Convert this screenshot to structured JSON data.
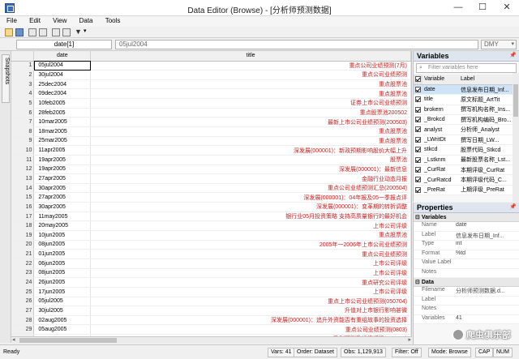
{
  "window": {
    "title": "Data Editor (Browse) - [分析师预测数据]",
    "controls": [
      "—",
      "☐",
      "✕"
    ]
  },
  "menu": [
    "File",
    "Edit",
    "View",
    "Data",
    "Tools"
  ],
  "varline": {
    "name": "date[1]",
    "value": "05jul2004",
    "format": "DMY"
  },
  "sidebar": {
    "snapshots_label": "Snapshots"
  },
  "grid": {
    "columns": [
      "date",
      "title"
    ],
    "rows": [
      {
        "n": "1",
        "date": "05jul2004",
        "title": "重点公司业绩预测(7月)"
      },
      {
        "n": "2",
        "date": "30jul2004",
        "title": "重点公司业绩预测"
      },
      {
        "n": "3",
        "date": "25dec2004",
        "title": "重点股票池"
      },
      {
        "n": "4",
        "date": "09dec2004",
        "title": "重点股票池"
      },
      {
        "n": "5",
        "date": "10feb2005",
        "title": "证券上市公司业绩预测"
      },
      {
        "n": "6",
        "date": "28feb2005",
        "title": "重点股票池200502"
      },
      {
        "n": "7",
        "date": "10mar2005",
        "title": "最新上市公司业绩预测(200503)"
      },
      {
        "n": "8",
        "date": "18mar2005",
        "title": "重点股票池"
      },
      {
        "n": "9",
        "date": "25mar2005",
        "title": "重点股票池"
      },
      {
        "n": "10",
        "date": "11apr2005",
        "title": "深发展(000001)：新政预期影响股价大幅上升"
      },
      {
        "n": "11",
        "date": "19apr2005",
        "title": "股票池"
      },
      {
        "n": "12",
        "date": "19apr2005",
        "title": "深发展(000001)：最新信息"
      },
      {
        "n": "13",
        "date": "27apr2005",
        "title": "金融行业动态月报"
      },
      {
        "n": "14",
        "date": "30apr2005",
        "title": "重点公司业绩预测汇总(200504)"
      },
      {
        "n": "15",
        "date": "27apr2005",
        "title": "深发展(000001)：04年报及05一季报点评"
      },
      {
        "n": "16",
        "date": "30apr2005",
        "title": "深发展(000001)：变革期的转折调整"
      },
      {
        "n": "17",
        "date": "11may2005",
        "title": "银行业05月投资策略 支持高质量银行的最好机会"
      },
      {
        "n": "18",
        "date": "20may2005",
        "title": "上市公司评级"
      },
      {
        "n": "19",
        "date": "10jun2005",
        "title": "重点股票池"
      },
      {
        "n": "20",
        "date": "08jun2005",
        "title": "2005年一2006年上市公司业绩预测"
      },
      {
        "n": "21",
        "date": "01jun2005",
        "title": "重点公司业绩预测"
      },
      {
        "n": "22",
        "date": "06jun2005",
        "title": "上市公司评级"
      },
      {
        "n": "23",
        "date": "08jun2005",
        "title": "上市公司评级"
      },
      {
        "n": "24",
        "date": "26jun2005",
        "title": "重点研究公司评级"
      },
      {
        "n": "25",
        "date": "17jun2005",
        "title": "上市公司评级"
      },
      {
        "n": "26",
        "date": "05jul2005",
        "title": "重点上市公司业绩预测(050704)"
      },
      {
        "n": "27",
        "date": "30jul2005",
        "title": "升值对上市银行影响甚微"
      },
      {
        "n": "28",
        "date": "02aug2005",
        "title": "深发展(000001)：追升外资能否有重组故事的投资选择"
      },
      {
        "n": "29",
        "date": "05aug2005",
        "title": "重点公司业绩预测(0803)"
      },
      {
        "n": "30",
        "date": "22aug2005",
        "title": "盈利预测及投资评级(050822)"
      },
      {
        "n": "31",
        "date": "23aug2005",
        "title": "重点股票评级"
      }
    ]
  },
  "variables": {
    "title": "Variables",
    "filter_placeholder": "Filter variables here",
    "col_variable": "Variable",
    "col_label": "Label",
    "items": [
      {
        "name": "date",
        "label": "信息发布日期_Inf..."
      },
      {
        "name": "title",
        "label": "原文标题_ArtTit"
      },
      {
        "name": "brokern",
        "label": "撰写机构名称_Ins..."
      },
      {
        "name": "_Brokcd",
        "label": "撰写机构编码_Bro..."
      },
      {
        "name": "analyst",
        "label": "分析师_Analyst"
      },
      {
        "name": "_LWritDt",
        "label": "撰写日期_LW..."
      },
      {
        "name": "stkcd",
        "label": "股票代码_Stkcd"
      },
      {
        "name": "_Lstknm",
        "label": "最新股票名称_Lst..."
      },
      {
        "name": "_CurRat",
        "label": "本期评级_CurRat"
      },
      {
        "name": "_CurRatcd",
        "label": "本期评级代码_C..."
      },
      {
        "name": "_PreRat",
        "label": "上期评级_PreRat"
      }
    ]
  },
  "properties": {
    "title": "Properties",
    "sections": [
      {
        "name": "Variables",
        "rows": [
          {
            "k": "Name",
            "v": "date"
          },
          {
            "k": "Label",
            "v": "信息发布日期_Inf..."
          },
          {
            "k": "Type",
            "v": "int"
          },
          {
            "k": "Format",
            "v": "%td"
          },
          {
            "k": "Value Label",
            "v": ""
          },
          {
            "k": "Notes",
            "v": ""
          }
        ]
      },
      {
        "name": "Data",
        "rows": [
          {
            "k": "Filename",
            "v": "分析师预测数据.d..."
          },
          {
            "k": "Label",
            "v": ""
          },
          {
            "k": "Notes",
            "v": ""
          },
          {
            "k": "Variables",
            "v": "41"
          }
        ]
      }
    ]
  },
  "status": {
    "ready": "Ready",
    "vars": "Vars: 41",
    "order": "Order: Dataset",
    "obs": "Obs: 1,129,913",
    "filter": "Filter: Off",
    "mode": "Mode: Browse",
    "cap": "CAP",
    "num": "NUM"
  },
  "watermark": "爬虫俱乐部"
}
